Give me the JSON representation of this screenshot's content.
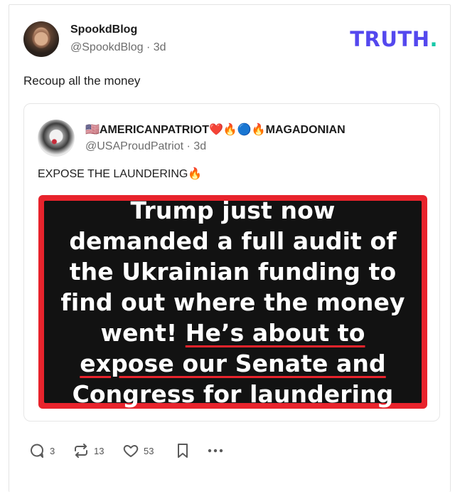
{
  "post": {
    "display_name": "SpookdBlog",
    "handle": "@SpookdBlog",
    "age": "3d",
    "text": "Recoup all the money"
  },
  "brand": {
    "name": "TRUTH",
    "dot": ".",
    "color": "#5448ee",
    "dot_color": "#17c8a8"
  },
  "quoted": {
    "display_name": "🇺🇸AMERICANPATRIOT❤️🔥🔵🔥MAGADONIAN",
    "handle": "@USAProudPatriot",
    "age": "3d",
    "text": "EXPOSE THE LAUNDERING🔥",
    "image_text": {
      "plain": "Trump just now demanded a full audit of the Ukrainian funding to find out where the money went!",
      "underlined": "He’s about to expose our Senate and Congress for laundering"
    }
  },
  "actions": {
    "reply_count": "3",
    "retruth_count": "13",
    "like_count": "53"
  },
  "icons": {
    "reply": "reply-icon",
    "retruth": "retruth-icon",
    "like": "heart-icon",
    "bookmark": "bookmark-icon",
    "more": "more-icon"
  }
}
